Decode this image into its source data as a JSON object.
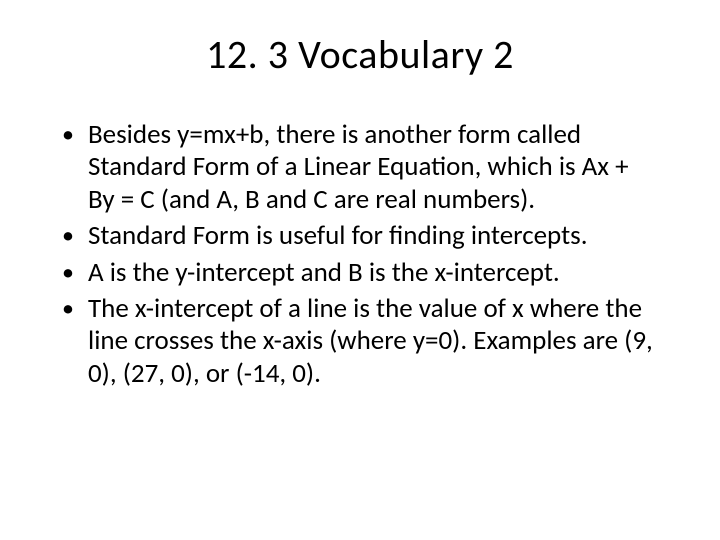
{
  "slide": {
    "title": "12. 3 Vocabulary 2",
    "bullets": [
      "Besides y=mx+b, there is another form called Standard Form of a Linear Equation, which is Ax + By = C (and A, B and C are real numbers).",
      "Standard Form is useful for finding intercepts.",
      "A is the y-intercept and B is the x-intercept.",
      "The x-intercept of a line is the value of x where the line crosses the x-axis (where y=0). Examples are (9, 0), (27, 0), or (-14, 0)."
    ]
  }
}
